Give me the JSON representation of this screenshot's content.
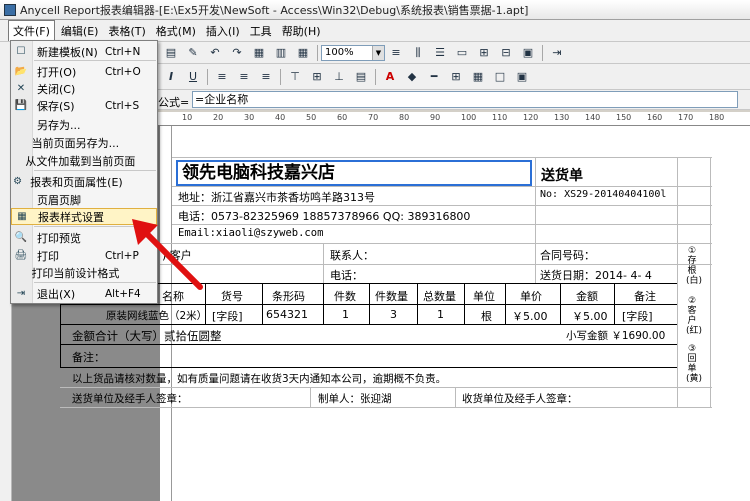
{
  "window": {
    "title": "Anycell Report报表编辑器-[E:\\Ex5开发\\NewSoft - Access\\Win32\\Debug\\系统报表\\销售票据-1.apt]"
  },
  "menubar": {
    "items": [
      "文件(F)",
      "编辑(E)",
      "表格(T)",
      "格式(M)",
      "插入(I)",
      "工具",
      "帮助(H)"
    ]
  },
  "toolbar": {
    "zoom": "100%"
  },
  "formula": {
    "label": "公式=",
    "value": "=企业名称"
  },
  "ruler": {
    "marks": [
      "10",
      "20",
      "30",
      "40",
      "50",
      "60",
      "70",
      "80",
      "90",
      "100",
      "110",
      "120",
      "130",
      "140",
      "150",
      "160",
      "170",
      "180"
    ]
  },
  "file_menu": {
    "items": [
      {
        "label": "新建模板(N)",
        "shortcut": "Ctrl+N"
      },
      {
        "label": "打开(O)",
        "shortcut": "Ctrl+O"
      },
      {
        "label": "关闭(C)",
        "shortcut": ""
      },
      {
        "label": "保存(S)",
        "shortcut": "Ctrl+S"
      },
      {
        "label": "另存为...",
        "shortcut": ""
      },
      {
        "label": "当前页面另存为...",
        "shortcut": ""
      },
      {
        "label": "从文件加载到当前页面",
        "shortcut": ""
      },
      {
        "label": "报表和页面属性(E)",
        "shortcut": ""
      },
      {
        "label": "页眉页脚",
        "shortcut": ""
      },
      {
        "label": "报表样式设置",
        "shortcut": ""
      },
      {
        "label": "打印预览",
        "shortcut": ""
      },
      {
        "label": "打印",
        "shortcut": "Ctrl+P"
      },
      {
        "label": "打印当前设计格式",
        "shortcut": ""
      },
      {
        "label": "退出(X)",
        "shortcut": "Alt+F4"
      }
    ]
  },
  "report": {
    "company": "领先电脑科技嘉兴店",
    "doc_title": "送货单",
    "doc_no": "No: XS29-20140404100l",
    "address": "地址：浙江省嘉兴市茶香坊鸣羊路313号",
    "phone": "电话：0573-82325969 18857378966 QQ: 389316800",
    "email": "Email:xiaoli@szyweb.com",
    "customer": ") 客户",
    "contact": "联系人：",
    "tel": "电话：",
    "contract_no": "合同号码：",
    "delivery_date": "送货日期：2014- 4- 4",
    "headers": [
      "名称",
      "货号",
      "条形码",
      "件数",
      "件数量",
      "总数量",
      "单位",
      "单价",
      "金额",
      "备注"
    ],
    "row": [
      "原装网线蓝色（2米）",
      "[字段]",
      "654321",
      "1",
      "3",
      "1",
      "根",
      "￥5.00",
      "￥5.00",
      "[字段]"
    ],
    "total_words": "金额合计（大写）贰拾伍圆整",
    "total_small": "小写金额 ￥1690.00",
    "remark": "备注：",
    "notice": "以上货品请核对数量，如有质量问题请在收货3天内通知本公司，逾期概不负责。",
    "sign_sender": "送货单位及经手人签章：",
    "sign_maker": "制单人：张迎湖",
    "sign_receiver": "收货单位及经手人签章：",
    "side1": "①存根(白)",
    "side2": "②客户(红)",
    "side3": "③回单(黄)"
  }
}
